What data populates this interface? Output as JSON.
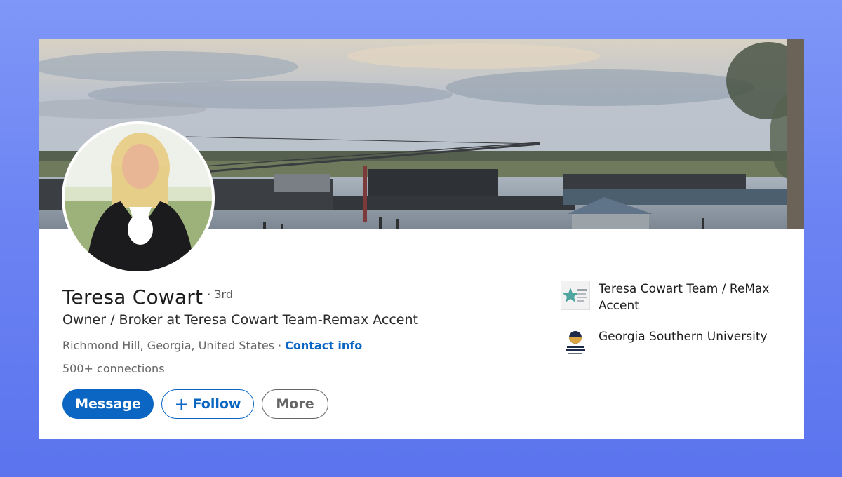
{
  "profile": {
    "name": "Teresa Cowart",
    "degree": "· 3rd",
    "headline": "Owner / Broker at Teresa Cowart Team-Remax Accent",
    "location": "Richmond Hill, Georgia, United States",
    "location_sep": "·",
    "contact_label": "Contact info",
    "connections": "500+ connections"
  },
  "actions": {
    "message_label": "Message",
    "follow_icon": "+",
    "follow_label": "Follow",
    "more_label": "More"
  },
  "orgs": [
    {
      "name": "Teresa Cowart Team / ReMax Accent",
      "icon": "company-logo"
    },
    {
      "name": "Georgia Southern University",
      "icon": "university-logo"
    }
  ],
  "colors": {
    "accent": "#0a66c2",
    "page_bg": "#6a82f2"
  }
}
